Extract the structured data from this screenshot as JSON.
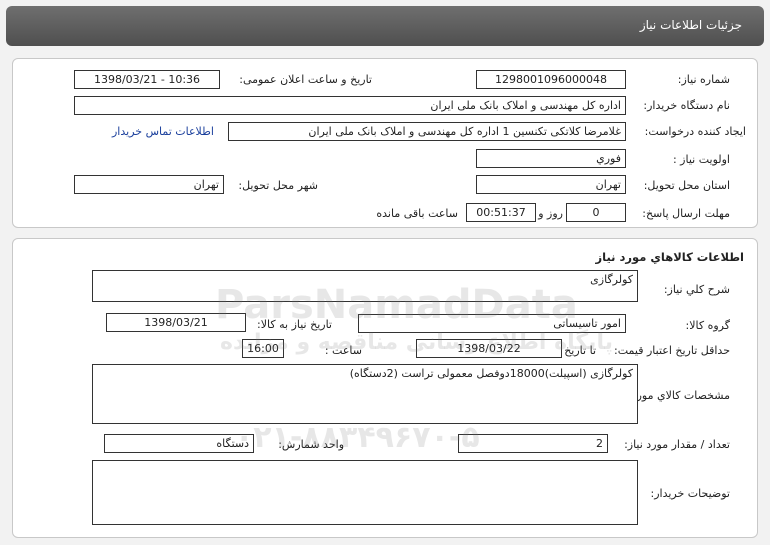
{
  "header": {
    "title": "جزئیات اطلاعات نیاز"
  },
  "need": {
    "number_label": "شماره نیاز:",
    "number": "1298001096000048",
    "announce_label": "تاریخ و ساعت اعلان عمومی:",
    "announce": "1398/03/21 - 10:36",
    "buyer_label": "نام دستگاه خریدار:",
    "buyer": "اداره کل مهندسی و املاک بانک ملی ایران",
    "creator_label": "ایجاد کننده درخواست:",
    "creator": "غلامرضا کلاتکی تکنسین 1 اداره کل مهندسی و املاک بانک ملی ایران",
    "contact_link": "اطلاعات تماس خریدار",
    "priority_label": "اولویت نیاز :",
    "priority": "فوري",
    "province_label": "استان محل تحویل:",
    "province": "تهران",
    "city_label": "شهر محل تحویل:",
    "city": "تهران",
    "deadline_label": "مهلت ارسال پاسخ:",
    "days": "0",
    "days_label": "روز و",
    "time": "00:51:37",
    "remain_label": "ساعت باقی مانده"
  },
  "goods": {
    "section_title": "اطلاعات کالاهاي مورد نياز",
    "desc_label": "شرح کلي نياز:",
    "desc": "کولرگازی",
    "group_label": "گروه کالا:",
    "group": "امور تاسیساتی",
    "need_date_label": "تاريخ نياز به کالا:",
    "need_date": "1398/03/21",
    "valid_label": "حداقل تاريخ اعتبار قيمت:",
    "to_date_label": "تا تاريخ :",
    "to_date": "1398/03/22",
    "hour_label": "ساعت :",
    "hour": "16:00",
    "spec_label": "مشخصات کالاي مورد نياز:",
    "spec": "کولرگازی (اسپیلت)18000دوفصل معمولی  تراست (2دستگاه)",
    "qty_label": "تعداد / مقدار مورد نياز:",
    "qty": "2",
    "unit_label": "واحد شمارش:",
    "unit": "دستگاه",
    "notes_label": "توضيحات خريدار:",
    "notes": ""
  },
  "watermark": {
    "brand": "ParsNamadData",
    "line1": "پایگاه اطلاع رسانی مناقصه و مزایده",
    "line2": "۰۲۱-۸۸۳۴۹۶۷۰-۵"
  }
}
